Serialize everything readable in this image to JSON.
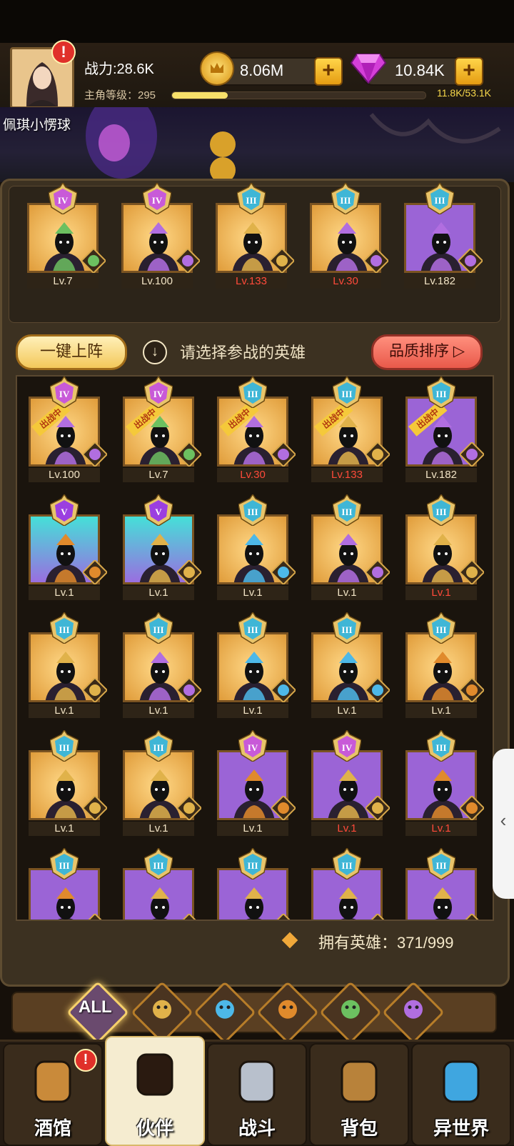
{
  "header": {
    "power_text": "战力:28.6K",
    "level_label": "主角等级：295",
    "level_progress": 0.22,
    "exp_text": "11.8K/53.1K",
    "gold_value": "8.06M",
    "gem_value": "10.84K",
    "plus_symbol": "+",
    "alert_symbol": "!",
    "player_name": "佩琪小愣球"
  },
  "lineup": [
    {
      "rank": "IV",
      "rank_color": "#c85ad8",
      "quality": "gold",
      "faction": "elf",
      "level": "Lv.7",
      "level_red": false
    },
    {
      "rank": "IV",
      "rank_color": "#c85ad8",
      "quality": "gold",
      "faction": "demon",
      "level": "Lv.100",
      "level_red": false
    },
    {
      "rank": "III",
      "rank_color": "#3fb6d6",
      "quality": "gold",
      "faction": "human",
      "level": "Lv.133",
      "level_red": true
    },
    {
      "rank": "III",
      "rank_color": "#3fb6d6",
      "quality": "gold",
      "faction": "demon",
      "level": "Lv.30",
      "level_red": true
    },
    {
      "rank": "III",
      "rank_color": "#3fb6d6",
      "quality": "purple",
      "faction": "demon",
      "level": "Lv.182",
      "level_red": false
    }
  ],
  "toolbar": {
    "quick_deploy": "一键上阵",
    "info_symbol": "↓",
    "instruction": "请选择参战的英雄",
    "sort_label": "品质排序 ▷"
  },
  "deployed_label": "出战中",
  "heroes": [
    {
      "rank": "IV",
      "rank_color": "#c85ad8",
      "quality": "gold",
      "faction": "demon",
      "level": "Lv.100",
      "level_red": false,
      "deployed": true
    },
    {
      "rank": "IV",
      "rank_color": "#c85ad8",
      "quality": "gold",
      "faction": "elf",
      "level": "Lv.7",
      "level_red": false,
      "deployed": true
    },
    {
      "rank": "III",
      "rank_color": "#3fb6d6",
      "quality": "gold",
      "faction": "demon",
      "level": "Lv.30",
      "level_red": true,
      "deployed": true
    },
    {
      "rank": "III",
      "rank_color": "#3fb6d6",
      "quality": "gold",
      "faction": "human",
      "level": "Lv.133",
      "level_red": true,
      "deployed": true
    },
    {
      "rank": "III",
      "rank_color": "#3fb6d6",
      "quality": "purple",
      "faction": "demon",
      "level": "Lv.182",
      "level_red": false,
      "deployed": true
    },
    {
      "rank": "V",
      "rank_color": "#9b3fe0",
      "quality": "cyan",
      "faction": "beast",
      "level": "Lv.1",
      "level_red": false,
      "deployed": false
    },
    {
      "rank": "V",
      "rank_color": "#9b3fe0",
      "quality": "cyan",
      "faction": "human",
      "level": "Lv.1",
      "level_red": false,
      "deployed": false
    },
    {
      "rank": "III",
      "rank_color": "#3fb6d6",
      "quality": "gold",
      "faction": "fish",
      "level": "Lv.1",
      "level_red": false,
      "deployed": false
    },
    {
      "rank": "III",
      "rank_color": "#3fb6d6",
      "quality": "gold",
      "faction": "demon",
      "level": "Lv.1",
      "level_red": false,
      "deployed": false
    },
    {
      "rank": "III",
      "rank_color": "#3fb6d6",
      "quality": "gold",
      "faction": "human",
      "level": "Lv.1",
      "level_red": true,
      "deployed": false
    },
    {
      "rank": "III",
      "rank_color": "#3fb6d6",
      "quality": "gold",
      "faction": "human",
      "level": "Lv.1",
      "level_red": false,
      "deployed": false
    },
    {
      "rank": "III",
      "rank_color": "#3fb6d6",
      "quality": "gold",
      "faction": "demon",
      "level": "Lv.1",
      "level_red": false,
      "deployed": false
    },
    {
      "rank": "III",
      "rank_color": "#3fb6d6",
      "quality": "gold",
      "faction": "fish",
      "level": "Lv.1",
      "level_red": false,
      "deployed": false
    },
    {
      "rank": "III",
      "rank_color": "#3fb6d6",
      "quality": "gold",
      "faction": "fish",
      "level": "Lv.1",
      "level_red": false,
      "deployed": false
    },
    {
      "rank": "III",
      "rank_color": "#3fb6d6",
      "quality": "gold",
      "faction": "beast",
      "level": "Lv.1",
      "level_red": false,
      "deployed": false
    },
    {
      "rank": "III",
      "rank_color": "#3fb6d6",
      "quality": "gold",
      "faction": "human",
      "level": "Lv.1",
      "level_red": false,
      "deployed": false
    },
    {
      "rank": "III",
      "rank_color": "#3fb6d6",
      "quality": "gold",
      "faction": "human",
      "level": "Lv.1",
      "level_red": false,
      "deployed": false
    },
    {
      "rank": "IV",
      "rank_color": "#c85ad8",
      "quality": "purple",
      "faction": "beast",
      "level": "Lv.1",
      "level_red": false,
      "deployed": false
    },
    {
      "rank": "IV",
      "rank_color": "#c85ad8",
      "quality": "purple",
      "faction": "human",
      "level": "Lv.1",
      "level_red": true,
      "deployed": false
    },
    {
      "rank": "III",
      "rank_color": "#3fb6d6",
      "quality": "purple",
      "faction": "beast",
      "level": "Lv.1",
      "level_red": true,
      "deployed": false
    },
    {
      "rank": "III",
      "rank_color": "#3fb6d6",
      "quality": "purple",
      "faction": "beast",
      "level": "",
      "level_red": false,
      "deployed": false
    },
    {
      "rank": "III",
      "rank_color": "#3fb6d6",
      "quality": "purple",
      "faction": "human",
      "level": "",
      "level_red": false,
      "deployed": false
    },
    {
      "rank": "III",
      "rank_color": "#3fb6d6",
      "quality": "purple",
      "faction": "human",
      "level": "",
      "level_red": false,
      "deployed": false
    },
    {
      "rank": "III",
      "rank_color": "#3fb6d6",
      "quality": "purple",
      "faction": "human",
      "level": "",
      "level_red": false,
      "deployed": false
    },
    {
      "rank": "III",
      "rank_color": "#3fb6d6",
      "quality": "purple",
      "faction": "human",
      "level": "",
      "level_red": false,
      "deployed": false
    }
  ],
  "owned_text": "拥有英雄：371/999",
  "filters": {
    "all_label": "ALL",
    "items": [
      "human-faction-icon",
      "fish-faction-icon",
      "beast-faction-icon",
      "elf-faction-icon",
      "demon-faction-icon"
    ]
  },
  "nav": [
    {
      "label": "酒馆",
      "icon": "tavern-icon",
      "active": false
    },
    {
      "label": "伙伴",
      "icon": "partner-icon",
      "active": true
    },
    {
      "label": "战斗",
      "icon": "battle-icon",
      "active": false
    },
    {
      "label": "背包",
      "icon": "backpack-icon",
      "active": false
    },
    {
      "label": "异世界",
      "icon": "portal-icon",
      "active": false
    }
  ],
  "side_tab_symbol": "‹",
  "colors": {
    "faction_human": "#e0b24a",
    "faction_demon": "#b16ee0",
    "faction_fish": "#4db8e8",
    "faction_beast": "#e08a2c",
    "faction_elf": "#6cc060"
  }
}
